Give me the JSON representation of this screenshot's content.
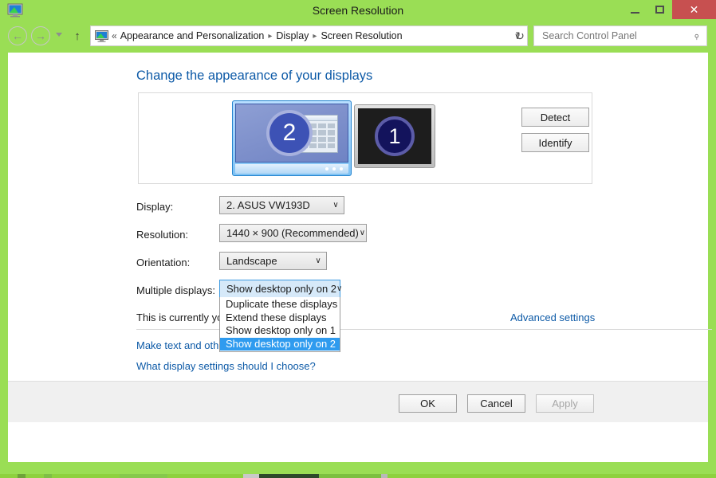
{
  "window": {
    "title": "Screen Resolution",
    "app_icon": "display-icon",
    "controls": {
      "minimize": "minimize-icon",
      "maximize": "maximize-icon",
      "close": "✕"
    },
    "frame_color": "#9ade55"
  },
  "navbar": {
    "back_icon": "←",
    "forward_icon": "→",
    "recent_icon": "chevron-down-icon",
    "up_icon": "↑",
    "address_icon": "display-icon",
    "breadcrumb_prefix": "«",
    "breadcrumbs": [
      "Appearance and Personalization",
      "Display",
      "Screen Resolution"
    ],
    "separator": "▸",
    "dropdown_icon": "∨",
    "refresh_icon": "↻",
    "search_placeholder": "Search Control Panel",
    "search_value": "",
    "search_icon": "⌕"
  },
  "page": {
    "title": "Change the appearance of your displays"
  },
  "preview": {
    "monitors": [
      {
        "number": "2",
        "state": "selected",
        "label": "monitor-2"
      },
      {
        "number": "1",
        "state": "inactive",
        "label": "monitor-1"
      }
    ],
    "detect_label": "Detect",
    "identify_label": "Identify"
  },
  "form": {
    "display": {
      "label": "Display:",
      "value": "2. ASUS VW193D",
      "arrow": "∨"
    },
    "resolution": {
      "label": "Resolution:",
      "value": "1440 × 900 (Recommended)",
      "arrow": "∨"
    },
    "orientation": {
      "label": "Orientation:",
      "value": "Landscape",
      "arrow": "∨"
    },
    "multiple_displays": {
      "label": "Multiple displays:",
      "value": "Show desktop only on 2",
      "arrow": "∨",
      "open": true,
      "options": [
        "Duplicate these displays",
        "Extend these displays",
        "Show desktop only on 1",
        "Show desktop only on 2"
      ],
      "selected_index": 3
    }
  },
  "notes": {
    "main_display": "This is currently your main display.",
    "advanced_settings_link": "Advanced settings",
    "text_size_link": "Make text and other items larger or smaller",
    "what_settings_link": "What display settings should I choose?"
  },
  "footer": {
    "ok_label": "OK",
    "cancel_label": "Cancel",
    "apply_label": "Apply",
    "apply_enabled": false
  },
  "colors": {
    "window_frame": "#9ade55",
    "close_button": "#c75050",
    "link_blue": "#0d5aa7",
    "highlight_blue": "#2f9bef",
    "focus_border": "#3f9ae0",
    "combo_focus_fill": "#d6e9f9"
  }
}
